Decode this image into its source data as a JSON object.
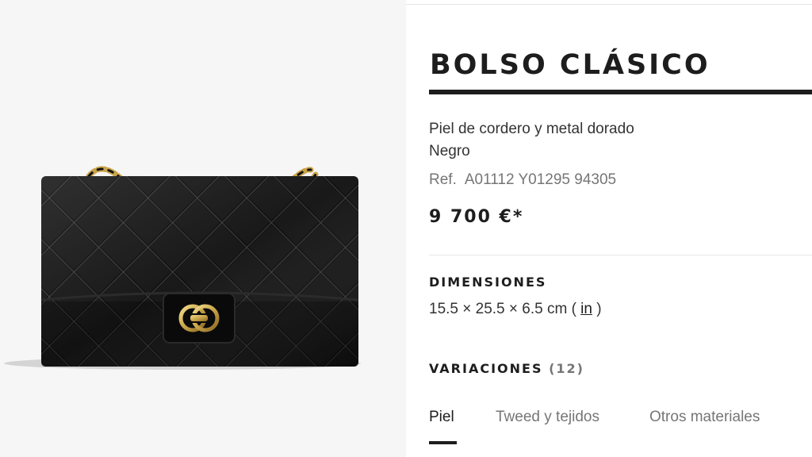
{
  "product": {
    "title": "BOLSO CLÁSICO",
    "material": "Piel de cordero y metal dorado",
    "color": "Negro",
    "ref_label": "Ref.",
    "ref_code": "A01112 Y01295 94305",
    "price": "9 700 €*"
  },
  "dimensions": {
    "heading": "DIMENSIONES",
    "value_prefix": "15.5 × 25.5 × 6.5 cm (",
    "unit_link": "in",
    "value_suffix": ")"
  },
  "variations": {
    "heading": "VARIACIONES",
    "count": "(12)",
    "tabs": [
      {
        "label": "Piel",
        "active": true
      },
      {
        "label": "Tweed y tejidos",
        "active": false
      },
      {
        "label": "Otros materiales",
        "active": false
      }
    ]
  },
  "colors": {
    "text": "#1d1d1d",
    "muted": "#767676",
    "gallery_bg": "#f6f6f6",
    "bag_leather": "#0c0c0c",
    "gold": "#c9a44a"
  },
  "icons": {
    "product_image": "quilted-black-flap-bag-image",
    "clasp": "cc-turnlock-clasp"
  }
}
